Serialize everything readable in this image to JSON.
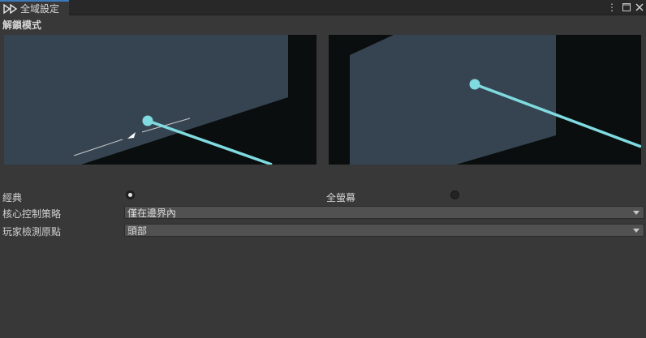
{
  "window": {
    "tab_title": "全域設定",
    "icons": [
      "logo-icon",
      "more-options-icon",
      "maximize-icon",
      "close-icon"
    ]
  },
  "unlock_mode": {
    "title": "解鎖模式",
    "options": [
      {
        "label": "經典",
        "selected": true
      },
      {
        "label": "全螢幕",
        "selected": false
      }
    ]
  },
  "settings": {
    "core_control": {
      "label": "核心控制策略",
      "value": "僅在邊界內"
    },
    "player_detect": {
      "label": "玩家檢測原點",
      "value": "頭部"
    }
  },
  "colors": {
    "background": "#383838",
    "preview_floor": "#364452",
    "preview_void": "#0a0e0e",
    "ray": "#7fdbe0",
    "accent": "#3a79bb"
  }
}
